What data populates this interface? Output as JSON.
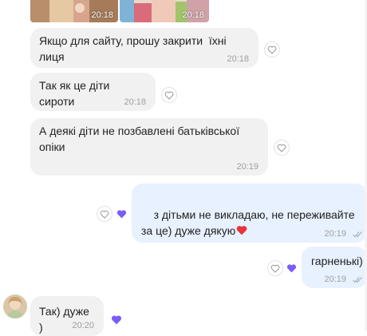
{
  "photos": [
    {
      "time": "20:18"
    },
    {
      "time": "20:18"
    }
  ],
  "messages": [
    {
      "text": "Якщо для сайту, прошу закрити  їхні лиця",
      "time": "20:18",
      "direction": "incoming"
    },
    {
      "text": "Так як це діти сироти",
      "time": "20:18",
      "direction": "incoming"
    },
    {
      "text": "А деякі діти не позбавлені батьківської опіки",
      "time": "20:19",
      "direction": "incoming"
    },
    {
      "text": "з дітьми не викладаю, не переживайте за це) дуже дякую",
      "time": "20:19",
      "direction": "outgoing",
      "emoji": "heart-emoji",
      "read": true
    },
    {
      "text": "гарненькі)",
      "time": "20:19",
      "direction": "outgoing",
      "read": true
    },
    {
      "text": "Так) дуже )",
      "time": "20:20",
      "direction": "incoming"
    }
  ],
  "colors": {
    "incoming_bubble": "#f1f1f1",
    "outgoing_bubble": "#e8f1ff",
    "reaction_heart": "#7b5cf5",
    "emoji_heart": "#e8333a",
    "timestamp": "#a0a0a0"
  },
  "icons": {
    "reaction_button": "heart-outline-icon",
    "reaction": "purple-heart-icon",
    "read_receipt": "double-check-icon"
  }
}
